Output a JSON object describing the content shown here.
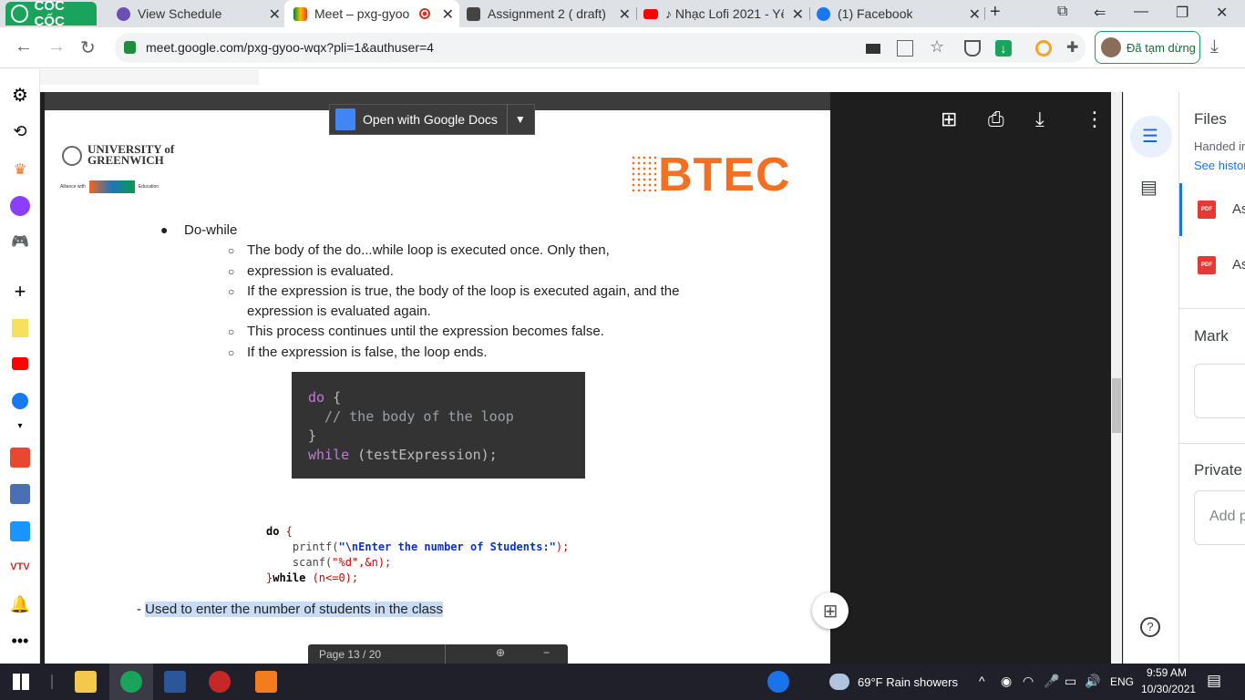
{
  "browser": {
    "brand": "CỐC CỐC",
    "tabs": [
      {
        "title": "View Schedule"
      },
      {
        "title": "Meet – pxg-gyoo"
      },
      {
        "title": "Assignment 2 ( draft)"
      },
      {
        "title": "♪ Nhạc Lofi 2021 - Yê"
      },
      {
        "title": "(1) Facebook"
      }
    ],
    "new_tab": "+",
    "url": "meet.google.com/pxg-gyoo-wqx?pli=1&authuser=4",
    "paused_label": "Đã tạm dừng"
  },
  "viewer": {
    "open_with_label": "Open with Google Docs"
  },
  "document": {
    "university_line1": "UNIVERSITY of",
    "university_line2": "GREENWICH",
    "alliance_text": "Alliance with",
    "alliance_edu": "Education",
    "btec": "BTEC",
    "bullet_title": "Do-while",
    "items": [
      "The body of the do...while loop is executed once. Only then,",
      "expression is evaluated.",
      "If the expression is true, the body of the loop is executed again, and the",
      "expression is evaluated again.",
      "This process continues until the expression becomes false.",
      "If the expression is false, the loop ends."
    ],
    "code1": {
      "line1_kw": "do",
      "line1_rest": " {",
      "line2": "  // the body of the loop",
      "line3": "}",
      "line4_kw": "while",
      "line4_rest": " (testExpression);"
    },
    "code2": {
      "l1_kw": "do",
      "l1_rest": " {",
      "l2_fn": "    printf(",
      "l2_str": "\"\\nEnter the number of Students:\"",
      "l2_end": ");",
      "l3_fn": "    scanf(",
      "l3_str": "\"%d\"",
      "l3_end": ",&n);",
      "l4_brace": "}",
      "l4_kw": "while",
      "l4_rest": " (n<=0);"
    },
    "note_prefix": "- ",
    "note": "Used to enter the number of students in the class",
    "page_label": "Page   13   /   20"
  },
  "panel": {
    "files_title": "Files",
    "handed_in": "Handed in",
    "see_history": "See history",
    "file1": "As",
    "file2": "As",
    "pdf_label": "PDF",
    "mark_title": "Mark",
    "private_title": "Private",
    "add_placeholder": "Add p"
  },
  "taskbar": {
    "weather": "69°F  Rain showers",
    "lang": "ENG",
    "time": "9:59 AM",
    "date": "10/30/2021"
  },
  "colors": {
    "brand_green": "#1aa35a",
    "btec_orange": "#f36f21",
    "viewer_dark": "#1e1e1e"
  }
}
